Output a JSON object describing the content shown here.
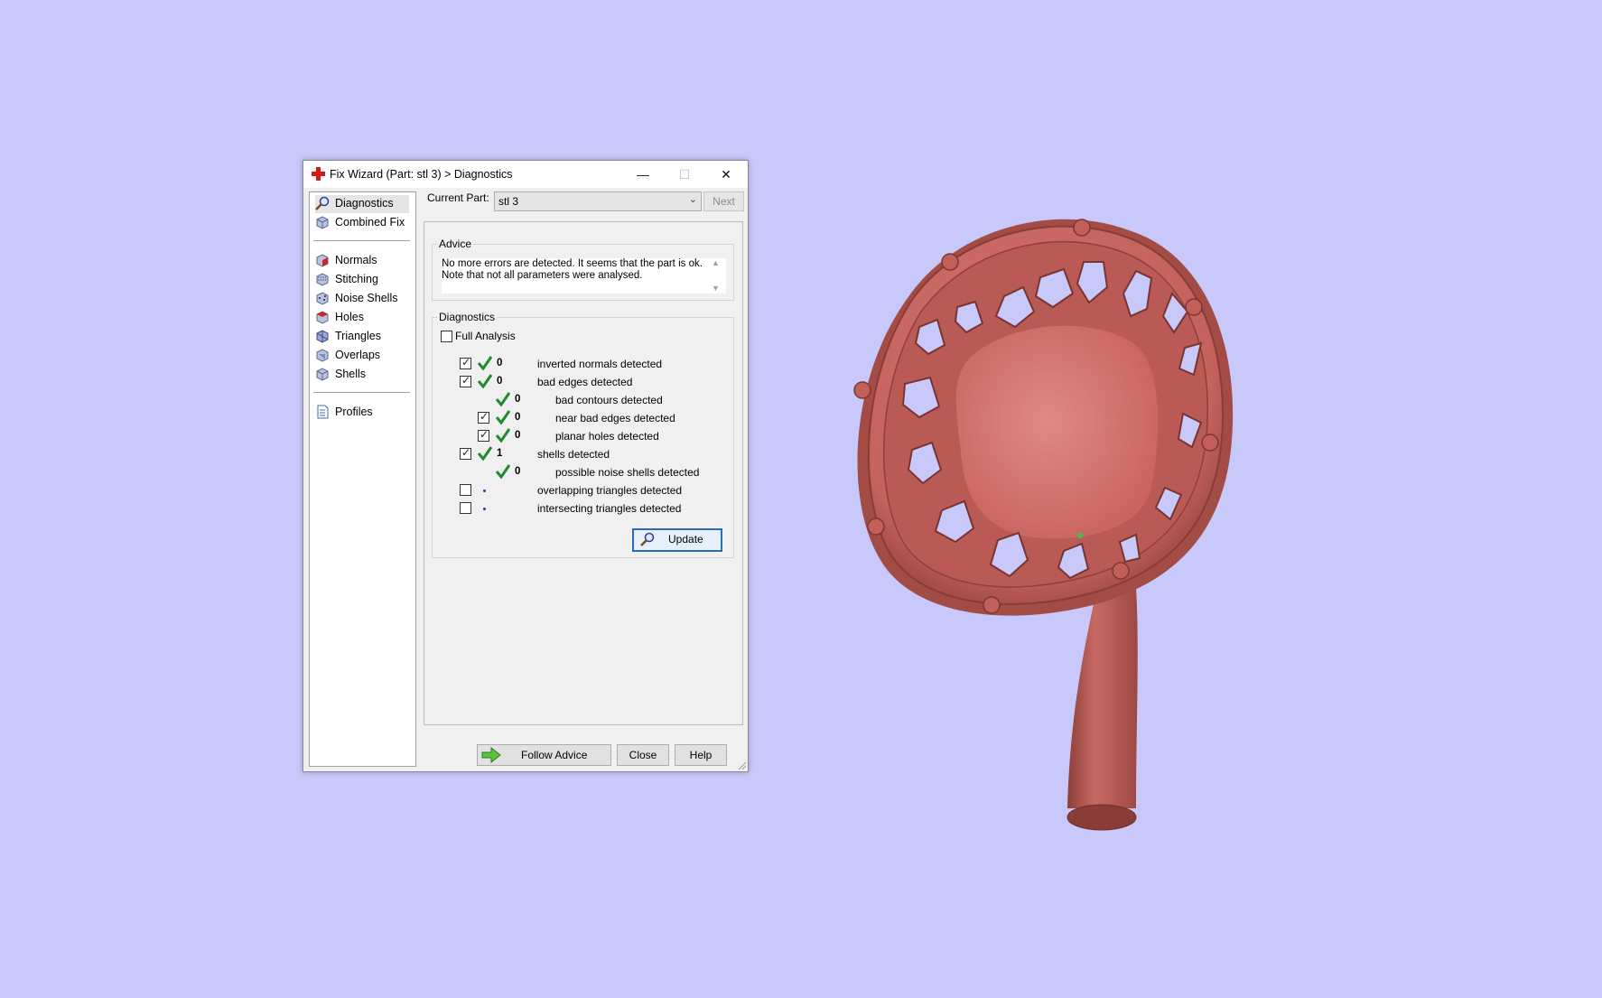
{
  "window": {
    "title": "Fix Wizard (Part: stl 3) > Diagnostics",
    "minimize_glyph": "—",
    "maximize_glyph": "☐",
    "close_glyph": "✕"
  },
  "nav": {
    "top_items": [
      {
        "label": "Diagnostics",
        "icon": "magnifier-icon",
        "selected": true
      },
      {
        "label": "Combined Fix",
        "icon": "cube-icon"
      }
    ],
    "fix_items": [
      {
        "label": "Normals",
        "icon": "normals-cube-icon"
      },
      {
        "label": "Stitching",
        "icon": "stitching-cube-icon"
      },
      {
        "label": "Noise Shells",
        "icon": "noise-shells-cube-icon"
      },
      {
        "label": "Holes",
        "icon": "holes-cube-icon"
      },
      {
        "label": "Triangles",
        "icon": "triangles-cube-icon"
      },
      {
        "label": "Overlaps",
        "icon": "overlaps-cube-icon"
      },
      {
        "label": "Shells",
        "icon": "shells-cube-icon"
      }
    ],
    "bottom_items": [
      {
        "label": "Profiles",
        "icon": "document-icon"
      }
    ]
  },
  "header": {
    "current_part_label": "Current Part:",
    "current_part_value": "stl 3",
    "next_label": "Next"
  },
  "advice": {
    "title": "Advice",
    "line1": "No more errors are detected. It seems that the part is ok.",
    "line2": "Note that not all parameters were analysed."
  },
  "diagnostics": {
    "title": "Diagnostics",
    "full_analysis_label": "Full Analysis",
    "full_analysis_checked": false,
    "rows": [
      {
        "label": "inverted normals detected",
        "count": "0",
        "checked": true,
        "has_checkbox": true,
        "indent": 0,
        "status": "ok"
      },
      {
        "label": "bad edges detected",
        "count": "0",
        "checked": true,
        "has_checkbox": true,
        "indent": 0,
        "status": "ok"
      },
      {
        "label": "bad contours detected",
        "count": "0",
        "checked": false,
        "has_checkbox": false,
        "indent": 1,
        "status": "ok"
      },
      {
        "label": "near bad edges detected",
        "count": "0",
        "checked": true,
        "has_checkbox": true,
        "indent": 1,
        "status": "ok"
      },
      {
        "label": "planar holes detected",
        "count": "0",
        "checked": true,
        "has_checkbox": true,
        "indent": 1,
        "status": "ok"
      },
      {
        "label": "shells detected",
        "count": "1",
        "checked": true,
        "has_checkbox": true,
        "indent": 0,
        "status": "ok"
      },
      {
        "label": "possible noise shells detected",
        "count": "0",
        "checked": false,
        "has_checkbox": false,
        "indent": 1,
        "status": "ok"
      },
      {
        "label": "overlapping triangles detected",
        "count": "",
        "checked": false,
        "has_checkbox": true,
        "indent": 0,
        "status": "not-analysed"
      },
      {
        "label": "intersecting triangles detected",
        "count": "",
        "checked": false,
        "has_checkbox": true,
        "indent": 0,
        "status": "not-analysed"
      }
    ],
    "update_label": "Update"
  },
  "footer": {
    "follow_advice_label": "Follow Advice",
    "close_label": "Close",
    "help_label": "Help"
  },
  "colors": {
    "background": "#c8c8fa",
    "model": "#cd6e68",
    "ok_tick": "#1f8a2e",
    "accent_button": "#2d6ab4"
  }
}
